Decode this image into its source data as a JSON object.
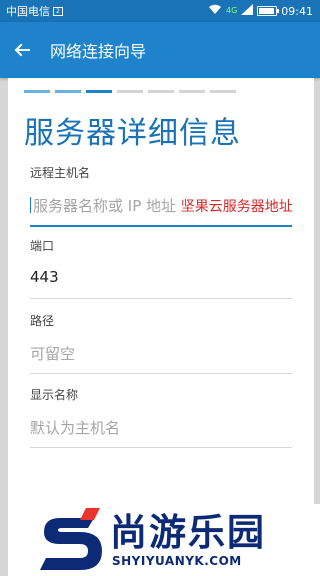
{
  "status_bar": {
    "carrier": "中国电信",
    "sim_label": "2",
    "network": "4G",
    "time": "09:41"
  },
  "app_bar": {
    "title": "网络连接向导"
  },
  "wizard": {
    "steps_total": 7,
    "current_step": 3
  },
  "page": {
    "title": "服务器详细信息"
  },
  "fields": {
    "hostname": {
      "label": "远程主机名",
      "placeholder": "服务器名称或 IP 地址",
      "annotation": "坚果云服务器地址"
    },
    "port": {
      "label": "端口",
      "value": "443"
    },
    "path": {
      "label": "路径",
      "placeholder": "可留空"
    },
    "display_name": {
      "label": "显示名称",
      "placeholder": "默认为主机名"
    }
  },
  "watermark": {
    "text_cn": "尚游乐园",
    "text_en": "SHYIYUANYK.COM"
  },
  "colors": {
    "status_bar": "#1a73b6",
    "app_bar": "#1e83cb",
    "accent": "#1e83cb",
    "annotation": "#d42a2a",
    "watermark": "#0c2a75"
  }
}
